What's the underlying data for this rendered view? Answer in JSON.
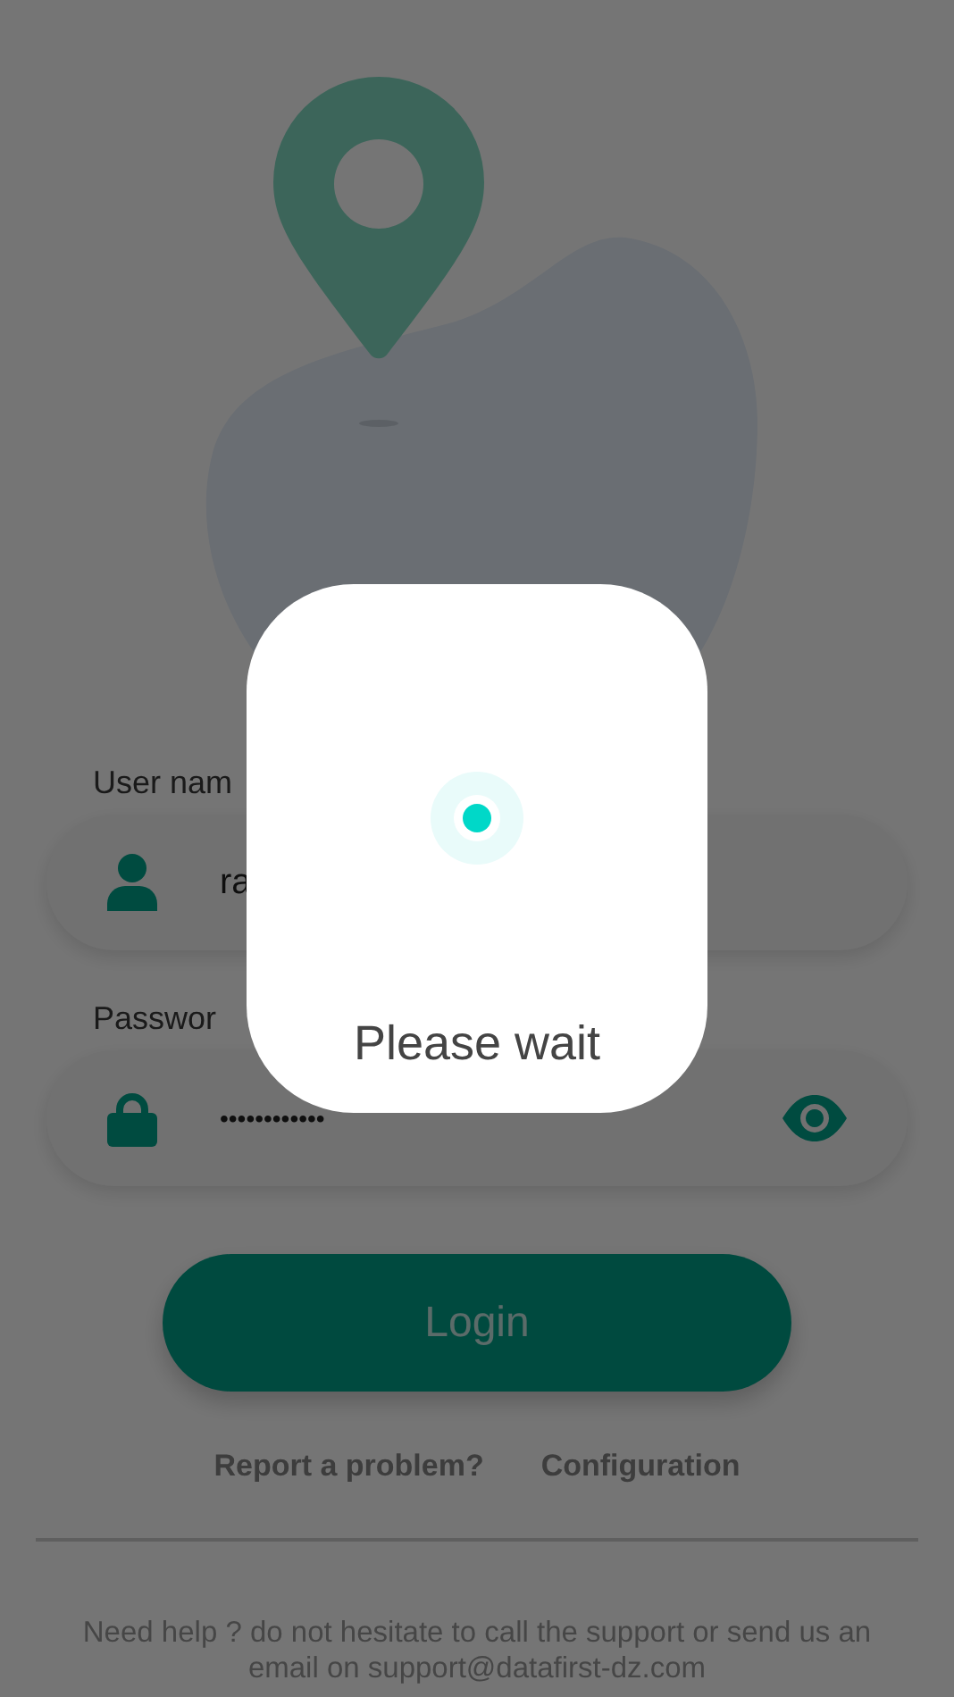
{
  "fields": [
    {
      "kind": "text",
      "label": "User nam",
      "value": "ra"
    },
    {
      "kind": "password",
      "label": "Passwor",
      "value": "••••••••••••"
    }
  ],
  "login_button": "Login",
  "links": [
    "Report a problem?",
    "Configuration"
  ],
  "help_text": "Need help ? do not hesitate to call the support or send us an email on support@datafirst-dz.com",
  "dialog": {
    "message": "Please wait"
  }
}
